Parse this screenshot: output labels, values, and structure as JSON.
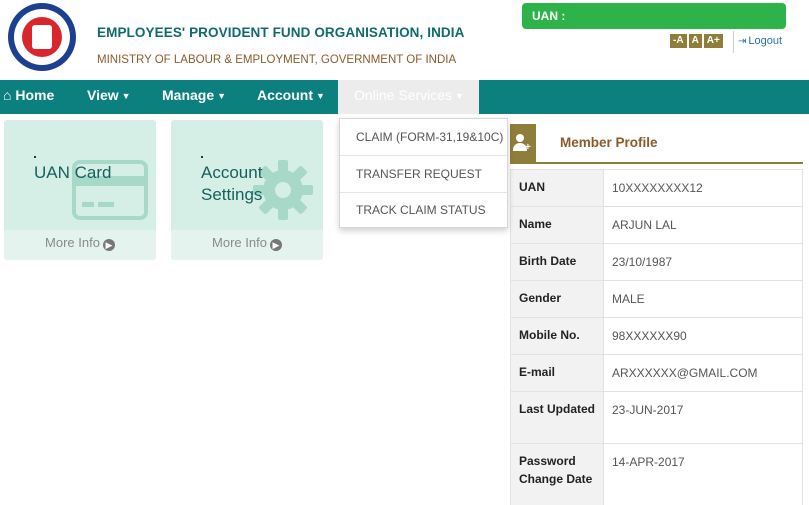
{
  "header": {
    "title": "EMPLOYEES' PROVIDENT FUND ORGANISATION, INDIA",
    "subtitle": "MINISTRY OF LABOUR & EMPLOYMENT, GOVERNMENT OF INDIA",
    "uan_label": "UAN :",
    "font_controls": [
      "-A",
      "A",
      "A+"
    ],
    "logout_label": "Logout"
  },
  "nav": {
    "home": "Home",
    "view": "View",
    "manage": "Manage",
    "account": "Account",
    "online_services": "Online Services"
  },
  "dropdown": {
    "items": [
      "CLAIM (FORM-31,19&10C)",
      "TRANSFER REQUEST",
      "TRACK CLAIM STATUS"
    ]
  },
  "tiles": [
    {
      "title": "UAN Card",
      "more": "More Info"
    },
    {
      "title": "Account Settings",
      "more": "More Info"
    }
  ],
  "profile": {
    "title": "Member Profile",
    "rows": [
      {
        "label": "UAN",
        "value": "10XXXXXXXX12"
      },
      {
        "label": "Name",
        "value": "ARJUN LAL"
      },
      {
        "label": "Birth Date",
        "value": "23/10/1987"
      },
      {
        "label": "Gender",
        "value": "MALE"
      },
      {
        "label": "Mobile No.",
        "value": "98XXXXXX90"
      },
      {
        "label": "E-mail",
        "value": "ARXXXXXX@GMAIL.COM"
      },
      {
        "label": "Last Updated",
        "value": "23-JUN-2017"
      },
      {
        "label": "Password Change Date",
        "value": "14-APR-2017"
      }
    ]
  },
  "colors": {
    "nav_bg": "#0c7f7f",
    "accent_brown": "#8f7d3a",
    "uan_green": "#2db34a",
    "tile_bg": "#d5eee6"
  }
}
